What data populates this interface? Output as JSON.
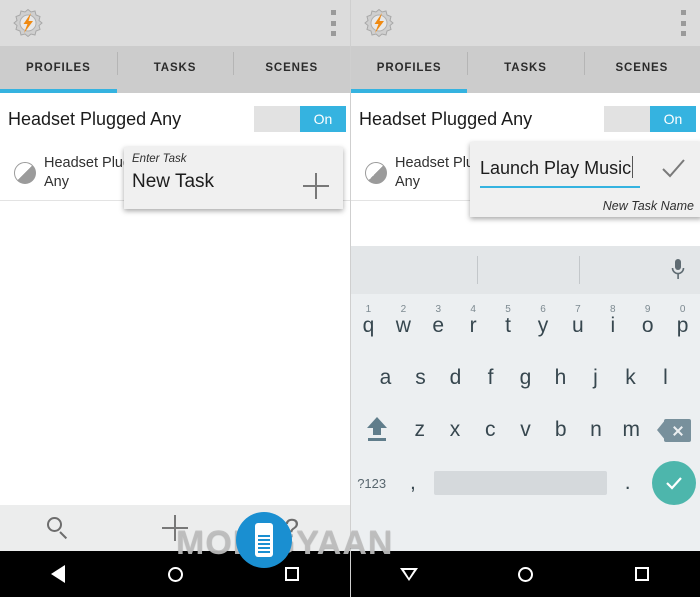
{
  "app": {
    "icon": "tasker-gear-icon",
    "overflow_menu": "overflow-menu-icon"
  },
  "tabs": [
    {
      "label": "PROFILES",
      "active": true
    },
    {
      "label": "TASKS",
      "active": false
    },
    {
      "label": "SCENES",
      "active": false
    }
  ],
  "profile": {
    "title": "Headset Plugged Any",
    "toggle_on_label": "On",
    "toggle_state": "on",
    "context_label": "Headset Plug Any"
  },
  "left_dialog": {
    "hint": "Enter Task",
    "value": "New Task",
    "add_icon": "plus-icon"
  },
  "right_dialog": {
    "value": "Launch Play Music",
    "hint": "New Task Name",
    "confirm_icon": "check-icon"
  },
  "action_bar": {
    "search_icon": "search-icon",
    "add_icon": "plus-icon",
    "help_label": "?"
  },
  "keyboard": {
    "suggestion_bar": {
      "mic_icon": "microphone-icon"
    },
    "row1": [
      {
        "key": "q",
        "num": "1"
      },
      {
        "key": "w",
        "num": "2"
      },
      {
        "key": "e",
        "num": "3"
      },
      {
        "key": "r",
        "num": "4"
      },
      {
        "key": "t",
        "num": "5"
      },
      {
        "key": "y",
        "num": "6"
      },
      {
        "key": "u",
        "num": "7"
      },
      {
        "key": "i",
        "num": "8"
      },
      {
        "key": "o",
        "num": "9"
      },
      {
        "key": "p",
        "num": "0"
      }
    ],
    "row2": [
      "a",
      "s",
      "d",
      "f",
      "g",
      "h",
      "j",
      "k",
      "l"
    ],
    "row3": [
      "z",
      "x",
      "c",
      "v",
      "b",
      "n",
      "m"
    ],
    "shift_icon": "shift-icon",
    "delete_icon": "backspace-icon",
    "symbols_label": "?123",
    "comma_label": ",",
    "period_label": ".",
    "space_label": "",
    "enter_icon": "check-icon"
  },
  "navbar": {
    "left": {
      "back_icon": "back-triangle-icon",
      "home_icon": "home-circle-icon",
      "recents_icon": "recents-square-icon"
    },
    "right": {
      "back_icon": "hide-keyboard-down-icon",
      "home_icon": "home-circle-icon",
      "recents_icon": "recents-square-icon"
    }
  },
  "watermark": {
    "text": "MOBIGYAAN",
    "logo": "mobigyaan-logo-icon"
  },
  "colors": {
    "accent": "#35b3e0",
    "appbar": "#dcdcdc",
    "tabbar": "#cccccc",
    "keyboard_bg": "#eceff1",
    "enter_key": "#4db6ac",
    "watermark_blue": "#1a8fd1"
  }
}
